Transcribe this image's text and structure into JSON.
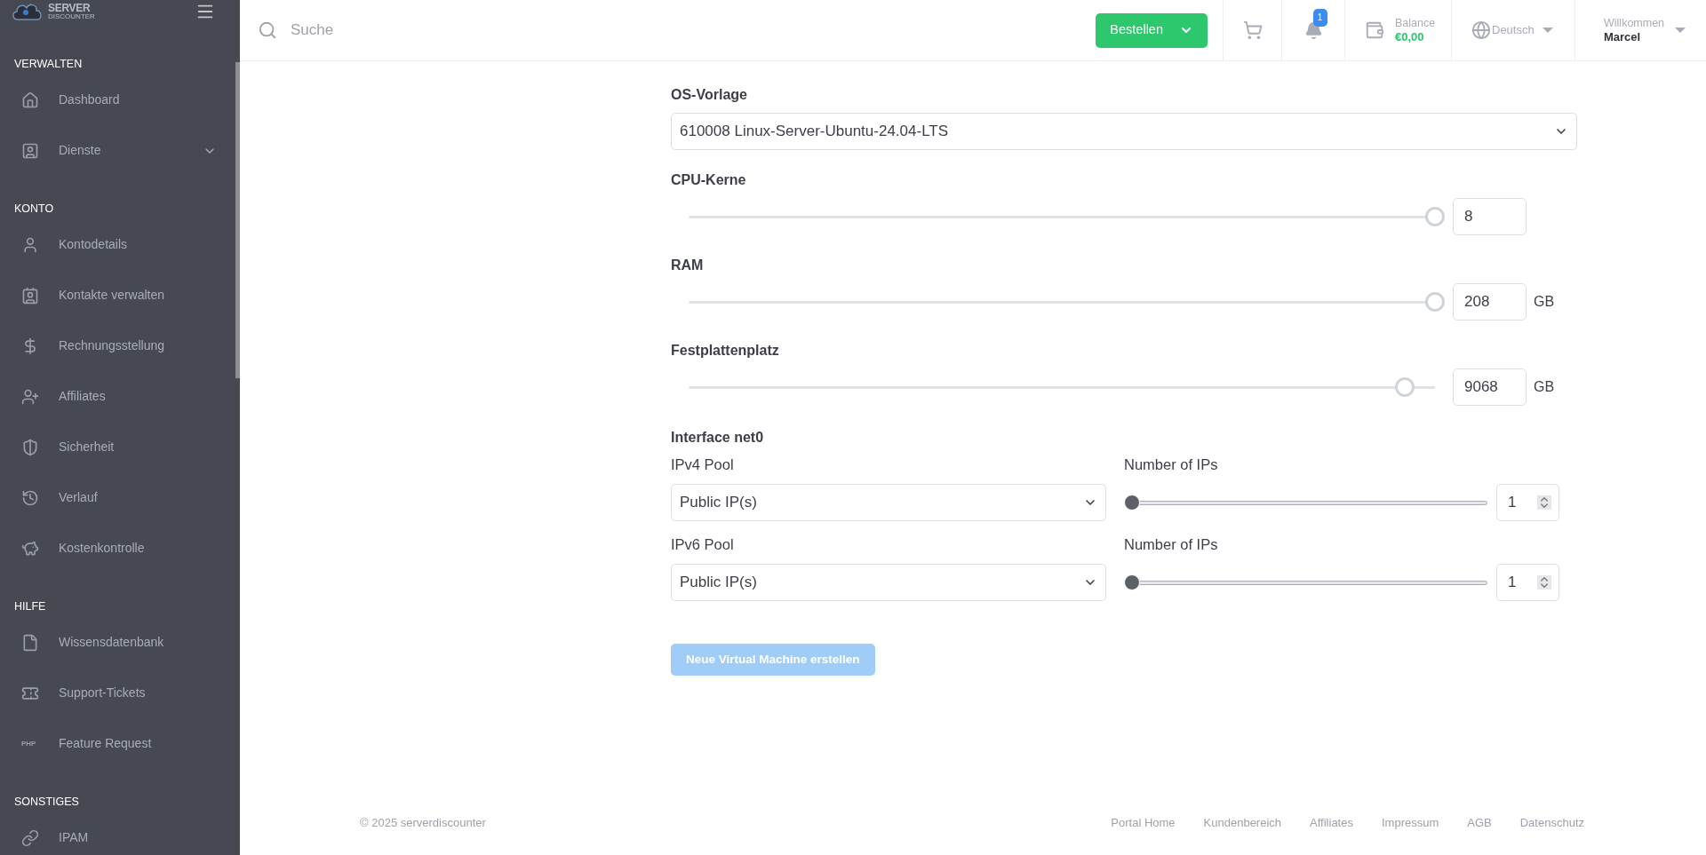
{
  "logo": {
    "line_1": "SERVER",
    "line_2": "DISCOUNTER"
  },
  "sidebar": {
    "sections": [
      {
        "title": "VERWALTEN",
        "items": [
          {
            "label": "Dashboard",
            "kind": "link"
          },
          {
            "label": "Dienste",
            "kind": "group"
          }
        ]
      },
      {
        "title": "KONTO",
        "items": [
          {
            "label": "Kontodetails",
            "kind": "link"
          },
          {
            "label": "Kontakte verwalten",
            "kind": "link"
          },
          {
            "label": "Rechnungsstellung",
            "kind": "link"
          },
          {
            "label": "Affiliates",
            "kind": "link"
          },
          {
            "label": "Sicherheit",
            "kind": "link"
          },
          {
            "label": "Verlauf",
            "kind": "link"
          },
          {
            "label": "Kostenkontrolle",
            "kind": "link"
          }
        ]
      },
      {
        "title": "HILFE",
        "items": [
          {
            "label": "Wissensdatenbank",
            "kind": "link"
          },
          {
            "label": "Support-Tickets",
            "kind": "link"
          },
          {
            "label": "Feature Request",
            "icon_text": "PHP",
            "kind": "link"
          }
        ]
      },
      {
        "title": "SONSTIGES",
        "items": [
          {
            "label": "IPAM",
            "kind": "link"
          }
        ]
      }
    ]
  },
  "topbar": {
    "search": {
      "placeholder": "Suche"
    },
    "order_button": "Bestellen",
    "notifications": "1",
    "balance": {
      "label": "Balance",
      "value": "€0,00"
    },
    "language": "Deutsch",
    "user": {
      "greeting": "Willkommen",
      "name": "Marcel"
    }
  },
  "form": {
    "os_template": {
      "label": "OS-Vorlage",
      "value": "610008 Linux-Server-Ubuntu-24.04-LTS"
    },
    "resources": [
      {
        "label": "CPU-Kerne",
        "level": 1,
        "value": "8"
      },
      {
        "label": "RAM",
        "level": 1,
        "value": "208",
        "unit": "GB"
      },
      {
        "label": "Festplattenplatz",
        "level": 0.96,
        "value": "9068",
        "unit": "GB"
      }
    ],
    "interface": {
      "title": "Interface net0",
      "pools": [
        {
          "label": "IPv4 Pool",
          "value": "Public IP(s)",
          "count_label": "Number of IPs",
          "level": 0,
          "count": "1"
        },
        {
          "label": "IPv6 Pool",
          "value": "Public IP(s)",
          "count_label": "Number of IPs",
          "level": 0,
          "count": "1"
        }
      ]
    },
    "submit": {
      "label": "Neue Virtual Machine erstellen",
      "disabled": true
    }
  },
  "footer": {
    "copyright": "© 2025 serverdiscounter",
    "links": [
      "Portal Home",
      "Kundenbereich",
      "Affiliates",
      "Impressum",
      "AGB",
      "Datenschutz"
    ]
  }
}
